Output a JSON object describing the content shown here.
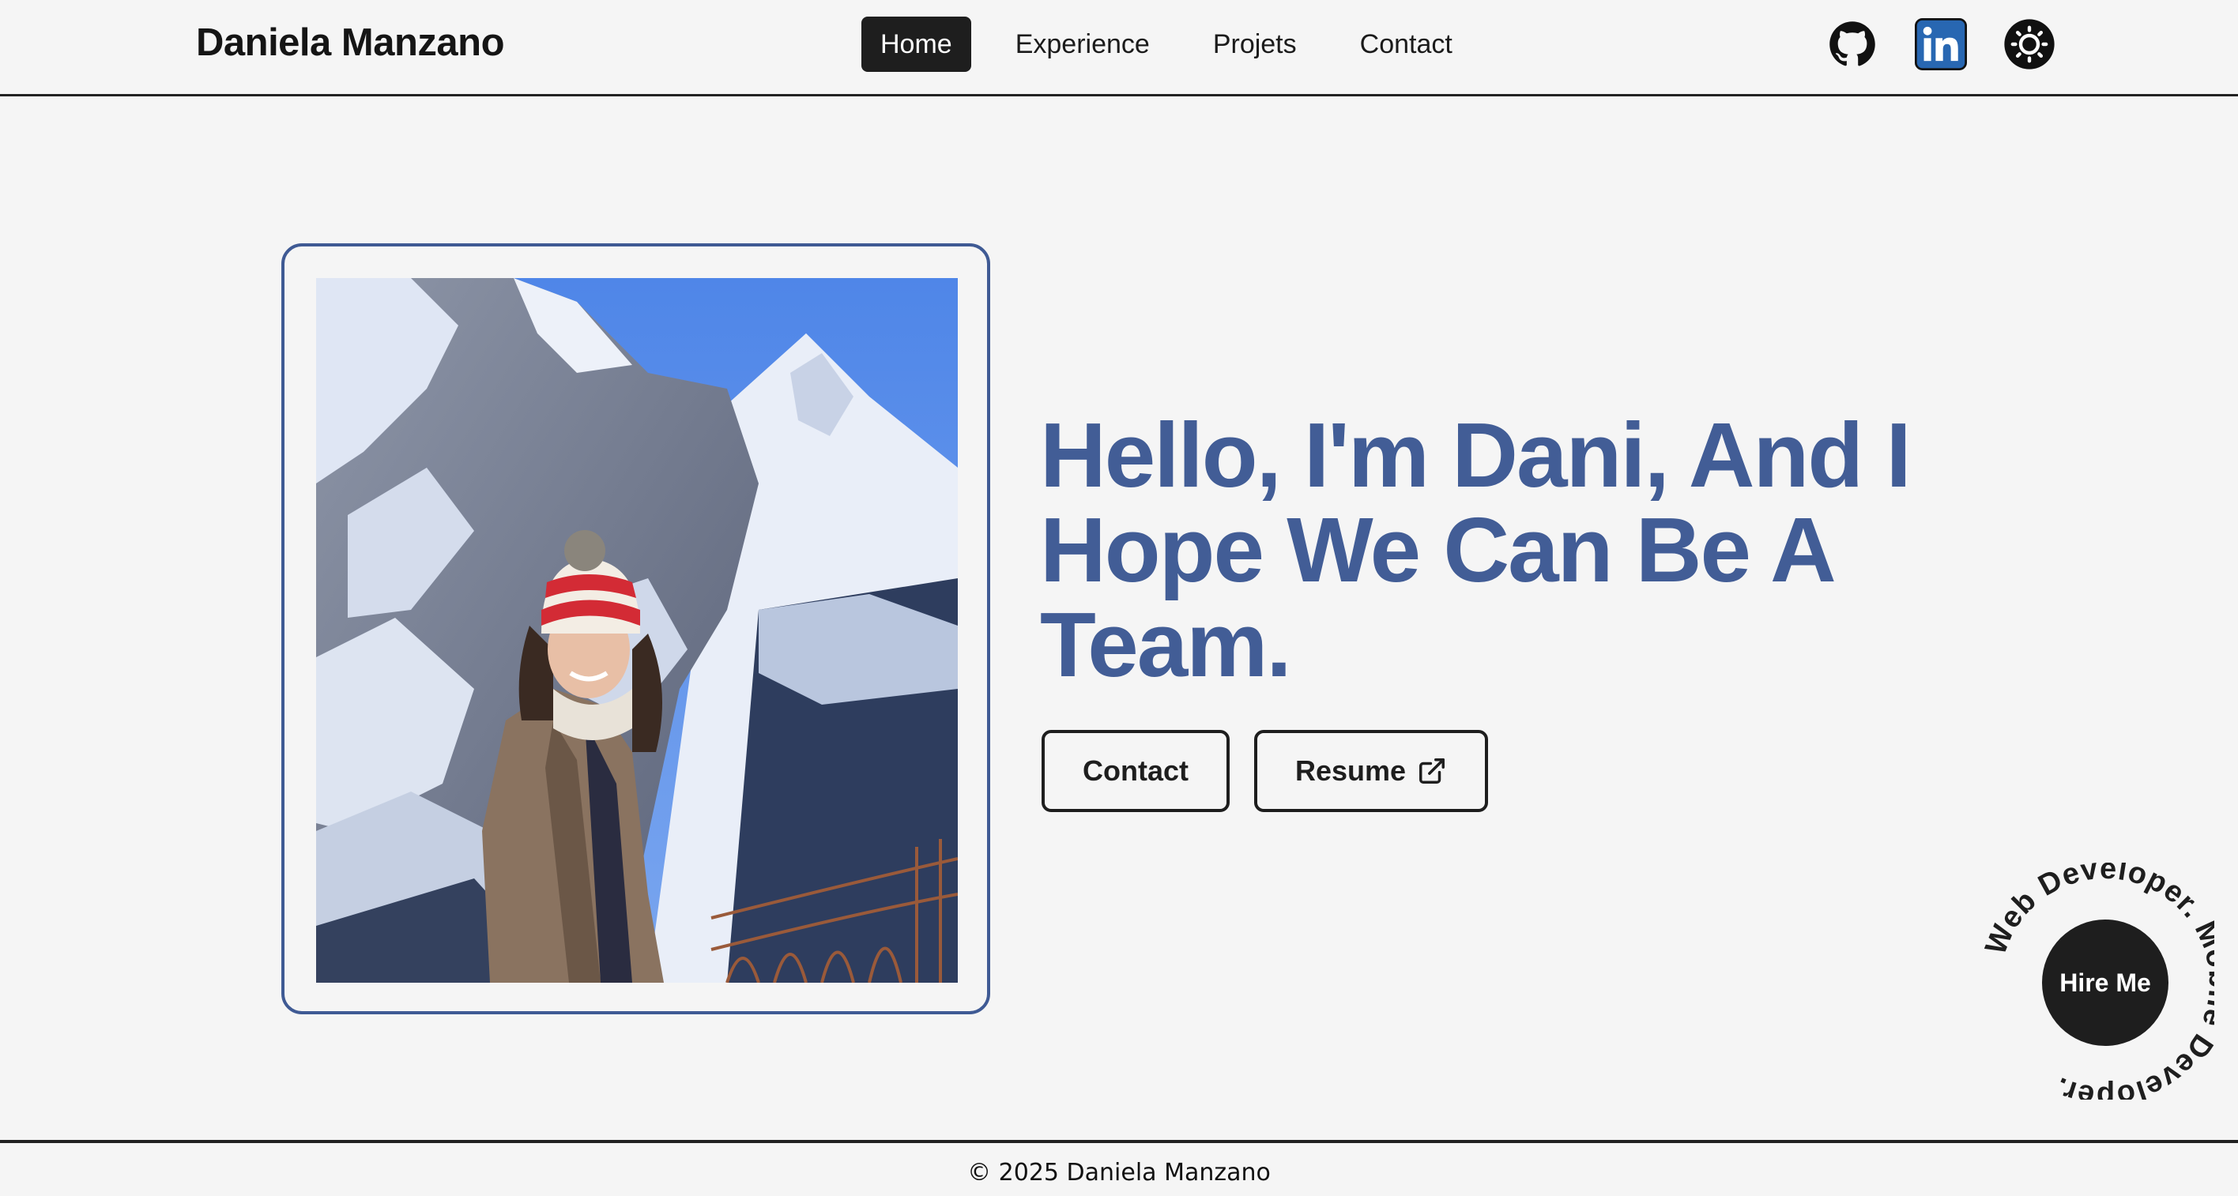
{
  "header": {
    "brand": "Daniela Manzano",
    "nav": [
      {
        "label": "Home",
        "active": true
      },
      {
        "label": "Experience",
        "active": false
      },
      {
        "label": "Projets",
        "active": false
      },
      {
        "label": "Contact",
        "active": false
      }
    ],
    "icons": [
      "github-icon",
      "linkedin-icon",
      "theme-toggle-icon"
    ]
  },
  "hero": {
    "photo_alt": "Daniela in front of snowy mountains",
    "headline": "Hello, I'm Dani, And I Hope We Can Be A Team.",
    "contact_label": "Contact",
    "resume_label": "Resume"
  },
  "badge": {
    "ring_text": "Web Developer. Mobile Developer.",
    "button_label": "Hire Me"
  },
  "footer": {
    "copyright": "© 2025 Daniela Manzano"
  },
  "colors": {
    "accent": "#425d96",
    "dark": "#1e1e1e",
    "background": "#f5f5f5",
    "linkedin": "#2867b2"
  }
}
